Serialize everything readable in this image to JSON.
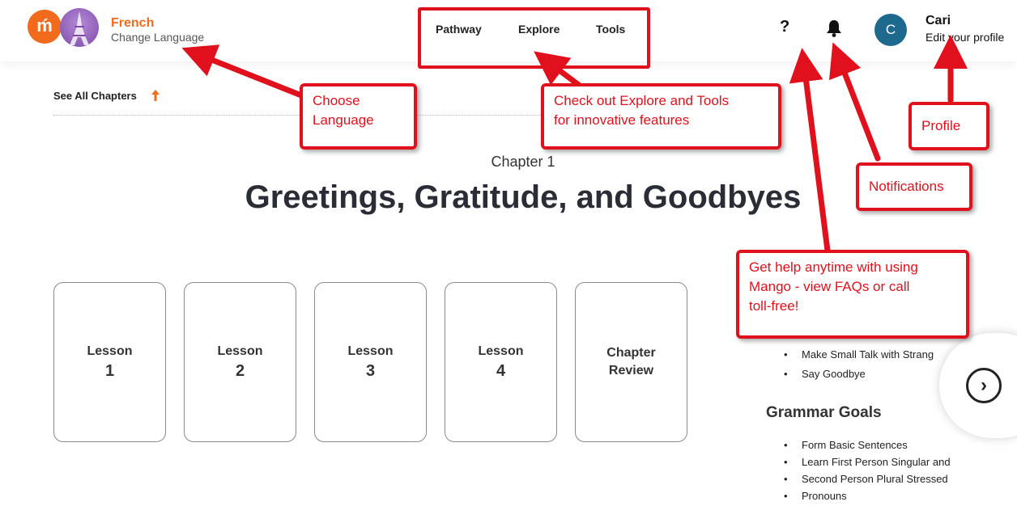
{
  "header": {
    "language_title": "French",
    "language_sub": "Change Language",
    "nav": [
      "Pathway",
      "Explore",
      "Tools"
    ],
    "help_label": "?",
    "user_initial": "C",
    "user_name": "Cari",
    "user_sub": "Edit your profile"
  },
  "main": {
    "see_all": "See All Chapters",
    "chapter_label": "Chapter 1",
    "chapter_title": "Greetings, Gratitude, and Goodbyes",
    "cards": [
      {
        "line1": "Lesson",
        "line2": "1"
      },
      {
        "line1": "Lesson",
        "line2": "2"
      },
      {
        "line1": "Lesson",
        "line2": "3"
      },
      {
        "line1": "Lesson",
        "line2": "4"
      },
      {
        "line1": "Chapter",
        "line2": "Review"
      }
    ],
    "conversation_goals": [
      "Make Small Talk with Strang",
      "Say Goodbye"
    ],
    "grammar_heading": "Grammar Goals",
    "grammar_goals": [
      "Form Basic Sentences",
      "Learn First Person Singular and",
      "Second Person Plural Stressed",
      "Pronouns"
    ]
  },
  "callouts": {
    "choose_language": [
      "Choose",
      "Language"
    ],
    "explore_tools": [
      "Check out Explore and Tools",
      "for innovative features"
    ],
    "profile": "Profile",
    "notifications": "Notifications",
    "help": [
      "Get help anytime with using",
      "Mango - view FAQs or call",
      "toll-free!"
    ]
  },
  "colors": {
    "brand_orange": "#f26a1b",
    "avatar_blue": "#1e6a8e",
    "callout_red": "#e0101c"
  },
  "icons": {
    "bell": "bell-icon",
    "help": "question-icon",
    "next": "chevron-right-icon",
    "see_all": "arrow-up-icon"
  }
}
